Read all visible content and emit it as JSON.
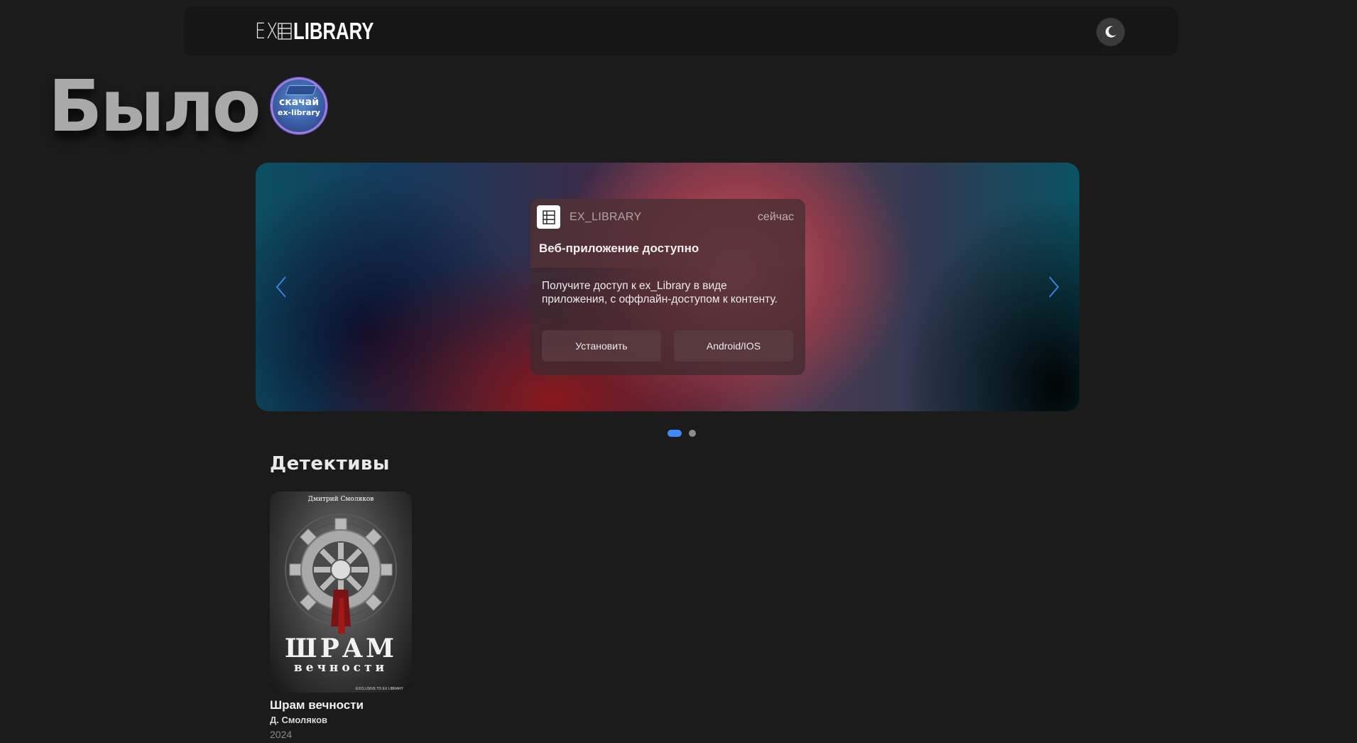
{
  "header": {
    "logo_ex": "EX",
    "logo_library": "LIBRARY",
    "theme_toggle_icon": "moon-icon"
  },
  "hero": {
    "title": "Было",
    "badge_line1": "скачай",
    "badge_line2": "ex-library"
  },
  "carousel": {
    "notification": {
      "app_name": "EX_LIBRARY",
      "time": "сейчас",
      "title": "Веб-приложение доступно",
      "body": "Получите доступ к ex_Library в виде приложения, с оффлайн-доступом к контенту.",
      "install_label": "Установить",
      "platform_label": "Android/IOS"
    },
    "slides_total": 2,
    "active_slide": 1
  },
  "section": {
    "title": "Детективы"
  },
  "books": [
    {
      "cover_author": "Дмитрий Смоляков",
      "cover_title_line1": "ШРАМ",
      "cover_title_line2": "вечности",
      "cover_footer": "EXCLUSIVE TO EX LIBRARY",
      "title": "Шрам вечности",
      "author": "Д. Смоляков",
      "year": "2024"
    }
  ],
  "colors": {
    "background": "#1b1b1b",
    "header": "#161616",
    "accent_dot": "#3d8cff"
  }
}
